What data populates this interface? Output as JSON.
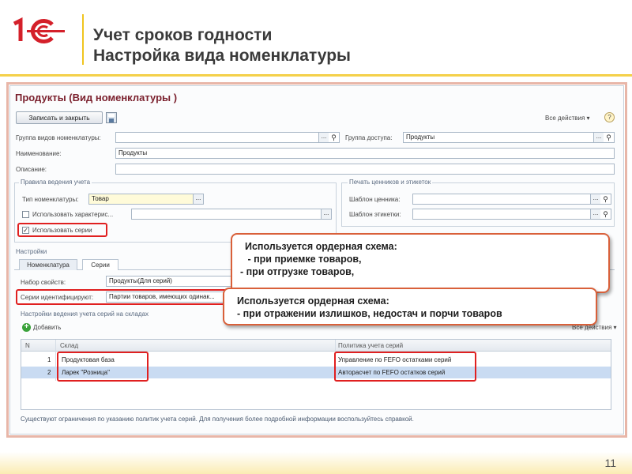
{
  "slide": {
    "title_line1": "Учет сроков годности",
    "title_line2": "Настройка вида номенклатуры",
    "page_number": "11",
    "logo_text": "1С"
  },
  "form": {
    "title": "Продукты (Вид номенклатуры )",
    "save_close_label": "Записать и закрыть",
    "all_actions_label": "Все действия ▾",
    "help_label": "?",
    "group_types_label": "Группа видов номенклатуры:",
    "group_types_value": "",
    "access_group_label": "Группа доступа:",
    "access_group_value": "Продукты",
    "name_label": "Наименование:",
    "name_value": "Продукты",
    "description_label": "Описание:",
    "description_value": "",
    "accounting_rules_title": "Правила ведения учета",
    "item_type_label": "Тип номенклатуры:",
    "item_type_value": "Товар",
    "use_characteristics_label": "Использовать характерис...",
    "use_series_label": "Использовать серии",
    "print_group_title": "Печать ценников и этикеток",
    "price_tag_label": "Шаблон ценника:",
    "label_template_label": "Шаблон этикетки:",
    "settings_title": "Настройки",
    "tab_nomenclature": "Номенклатура",
    "tab_series": "Серии",
    "property_set_label": "Набор свойств:",
    "property_set_value": "Продукты(Для серий)",
    "series_identified_label": "Серии идентифицируют:",
    "series_identified_value": "Партии товаров, имеющих одинак...",
    "warehouse_settings_title": "Настройки ведения учета серий на складах",
    "add_label": "Добавить",
    "all_actions2_label": "Все действия ▾",
    "table": {
      "headers": [
        "N",
        "Склад",
        "Политика учета серий"
      ],
      "rows": [
        {
          "n": "1",
          "warehouse": "Продуктовая база",
          "policy": "Управление по FEFO остатками серий"
        },
        {
          "n": "2",
          "warehouse": "Ларек \"Розница\"",
          "policy": "Авторасчет по FEFO остатков серий"
        }
      ]
    },
    "footnote": "Существуют ограничения по указанию политик учета серий. Для получения более подробной информации воспользуйтесь справкой."
  },
  "callouts": {
    "first": {
      "line1": "Используется ордерная схема:",
      "line2": " - при приемке товаров,",
      "line3": "- при отгрузке товаров,"
    },
    "second": {
      "line1": "Используется ордерная схема:",
      "line2": "- при отражении излишков, недостач и порчи товаров"
    }
  },
  "colors": {
    "accent_red": "#e02020",
    "title_red": "#7a1f2c",
    "header_gold": "#f2c21a",
    "selected_row": "#c9dbf2"
  }
}
